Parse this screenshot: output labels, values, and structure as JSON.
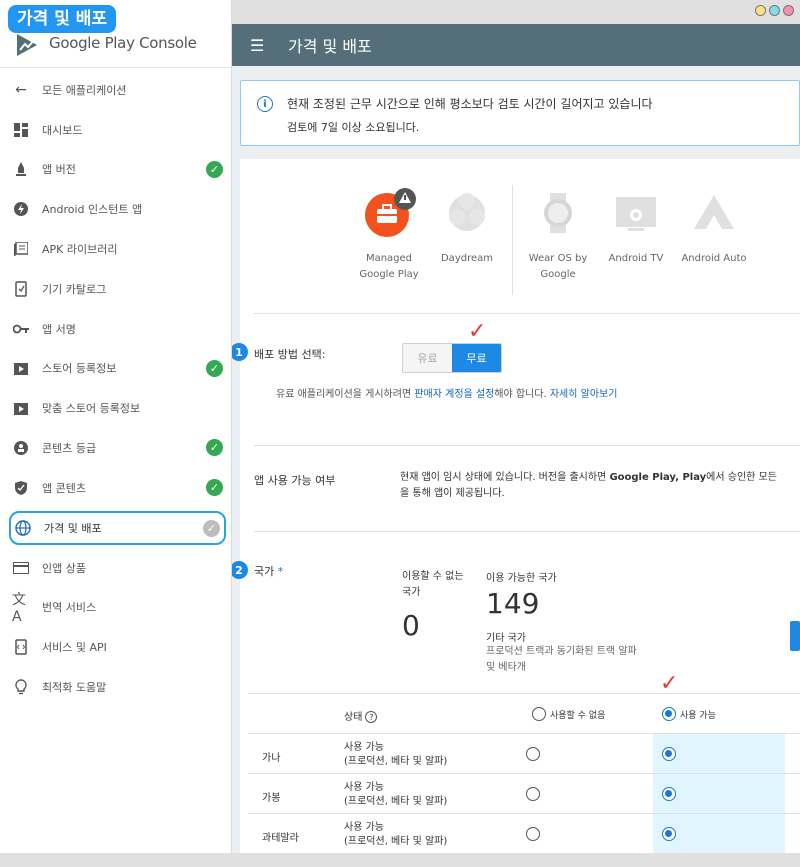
{
  "callout_title": "가격 및 배포",
  "logo": {
    "brand": "Google Play",
    "product": "Console"
  },
  "sidebar": {
    "items": [
      {
        "label": "모든 애플리케이션",
        "icon": "arrow-left-icon",
        "check": false
      },
      {
        "label": "대시보드",
        "icon": "dashboard-icon",
        "check": false
      },
      {
        "label": "앱 버전",
        "icon": "rocket-icon",
        "check": true
      },
      {
        "label": "Android 인스턴트 앱",
        "icon": "bolt-icon",
        "check": false
      },
      {
        "label": "APK 라이브러리",
        "icon": "library-icon",
        "check": false
      },
      {
        "label": "기기 카탈로그",
        "icon": "device-catalog-icon",
        "check": false
      },
      {
        "label": "앱 서명",
        "icon": "key-icon",
        "check": false
      },
      {
        "label": "스토어 등록정보",
        "icon": "store-icon",
        "check": true
      },
      {
        "label": "맞춤 스토어 등록정보",
        "icon": "store-icon",
        "check": false
      },
      {
        "label": "콘텐츠 등급",
        "icon": "rating-icon",
        "check": true
      },
      {
        "label": "앱 콘텐츠",
        "icon": "shield-icon",
        "check": true
      },
      {
        "label": "가격 및 배포",
        "icon": "globe-icon",
        "check": true,
        "selected": true
      },
      {
        "label": "인앱 상품",
        "icon": "card-icon",
        "check": false
      },
      {
        "label": "번역 서비스",
        "icon": "translate-icon",
        "check": false
      },
      {
        "label": "서비스 및 API",
        "icon": "api-icon",
        "check": false
      },
      {
        "label": "최적화 도움말",
        "icon": "lightbulb-icon",
        "check": false
      }
    ]
  },
  "topbar": {
    "title": "가격 및 배포"
  },
  "banner": {
    "line1": "현재 조정된 근무 시간으로 인해 평소보다 검토 시간이 길어지고 있습니다",
    "line2": "검토에 7일 이상 소요됩니다."
  },
  "devices": [
    {
      "label1": "Managed",
      "label2": "Google Play",
      "icon": "briefcase-icon"
    },
    {
      "label1": "Daydream",
      "label2": "",
      "icon": "daydream-icon"
    },
    {
      "label1": "Wear OS by",
      "label2": "Google",
      "icon": "watch-icon"
    },
    {
      "label1": "Android TV",
      "label2": "",
      "icon": "tv-icon"
    },
    {
      "label1": "Android Auto",
      "label2": "",
      "icon": "auto-icon"
    }
  ],
  "pricing": {
    "step": "1",
    "label": "배포 방법 선택:",
    "paid": "유료",
    "free": "무료",
    "note_pre": "유료 애플리케이션을 게시하려면 ",
    "note_link": "판매자 계정을 설정",
    "note_mid": "해야 합니다. ",
    "note_link2": "자세히 알아보기"
  },
  "availability": {
    "label": "앱 사용 가능 여부",
    "text_a": "현재 앱이 임시 상태에 있습니다. 버전을 출시하면 ",
    "text_b": "Google Play, Play",
    "text_c": "에서 승인한 모든",
    "text_d": "을 통해 앱이 제공됩니다."
  },
  "countries": {
    "step": "2",
    "label": "국가",
    "required": "*",
    "unavailable_label1": "이용할 수 없는",
    "unavailable_label2": "국가",
    "unavailable_count": "0",
    "available_label": "이용 가능한 국가",
    "available_count": "149",
    "other_label": "기타 국가",
    "other_desc1": "프로덕션 트랙과 동기화된 트랙 알파",
    "other_desc2": "및 베타개"
  },
  "table": {
    "status_header": "상태",
    "col_unavailable": "사용할 수 없음",
    "col_available": "사용 가능",
    "rows": [
      {
        "country": "가나",
        "status1": "사용 가능",
        "status2": "(프로덕션, 베타 및 알파)"
      },
      {
        "country": "가봉",
        "status1": "사용 가능",
        "status2": "(프로덕션, 베타 및 알파)"
      },
      {
        "country": "과테말라",
        "status1": "사용 가능",
        "status2": "(프로덕션, 베타 및 알파)"
      }
    ]
  },
  "colors": {
    "accent": "#1e88e5",
    "topbar": "#546e7a",
    "check_green": "#34a853",
    "red_mark": "#e53935"
  }
}
